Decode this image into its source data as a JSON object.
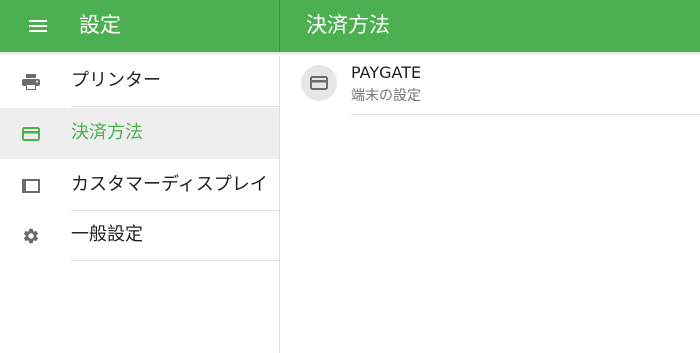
{
  "appbar": {
    "left_title": "設定",
    "right_title": "決済方法",
    "menu_icon": "menu-icon",
    "color": "#4caf50"
  },
  "sidebar": {
    "items": [
      {
        "label": "プリンター",
        "icon": "printer-icon",
        "selected": false
      },
      {
        "label": "決済方法",
        "icon": "credit-card-icon",
        "selected": true
      },
      {
        "label": "カスタマーディスプレイ",
        "icon": "display-icon",
        "selected": false
      },
      {
        "label": "一般設定",
        "icon": "gear-icon",
        "selected": false
      }
    ]
  },
  "content": {
    "payment_item": {
      "title": "PAYGATE",
      "subtitle": "端末の設定",
      "icon": "credit-card-icon"
    }
  }
}
